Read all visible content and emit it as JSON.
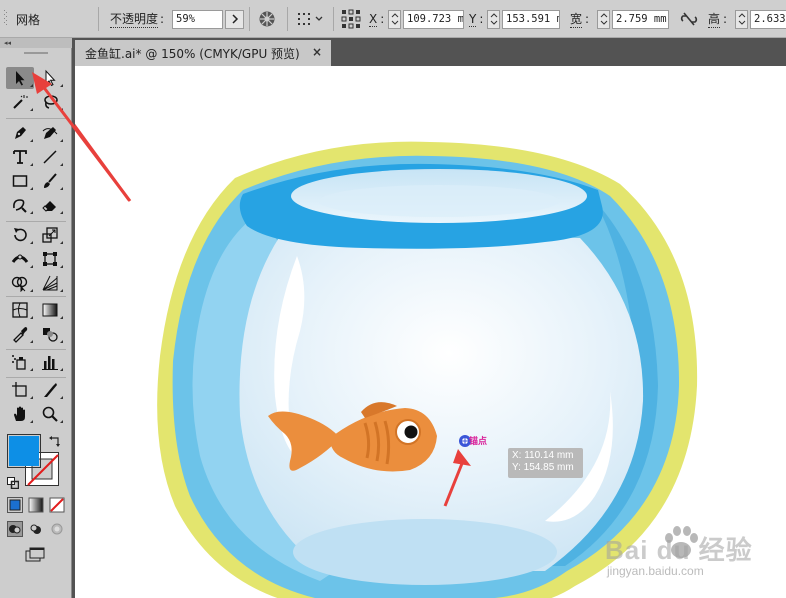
{
  "toolbar": {
    "panel_label": "网格",
    "opacity_label": "不透明度",
    "opacity_colon": ":",
    "opacity_value": "59%",
    "x_label": "X",
    "x_value": "109.723 m",
    "y_label": "Y",
    "y_value": "153.591 m",
    "width_label": "宽",
    "width_value": "2.759 mm",
    "height_label": "高",
    "height_value": "2.633"
  },
  "document_tab": {
    "title": "金鱼缸.ai* @ 150% (CMYK/GPU 预览)",
    "close_glyph": "×"
  },
  "tools_panel": {
    "collapse_glyph": "◂◂"
  },
  "canvas": {
    "anchor_label": "锚点",
    "tooltip_x": "X: 110.14 mm",
    "tooltip_y": "Y: 154.85 mm"
  },
  "watermark": {
    "brand": "Bai du 经验",
    "url": "jingyan.baidu.com"
  },
  "colors": {
    "fill": "#0d8fe6",
    "stroke": "#ffffff",
    "annotation_arrow": "#e8403c",
    "bowl_outline": "#e3e56e",
    "bowl_rim": "#27a3e3",
    "fish": "#eb8e3d"
  }
}
